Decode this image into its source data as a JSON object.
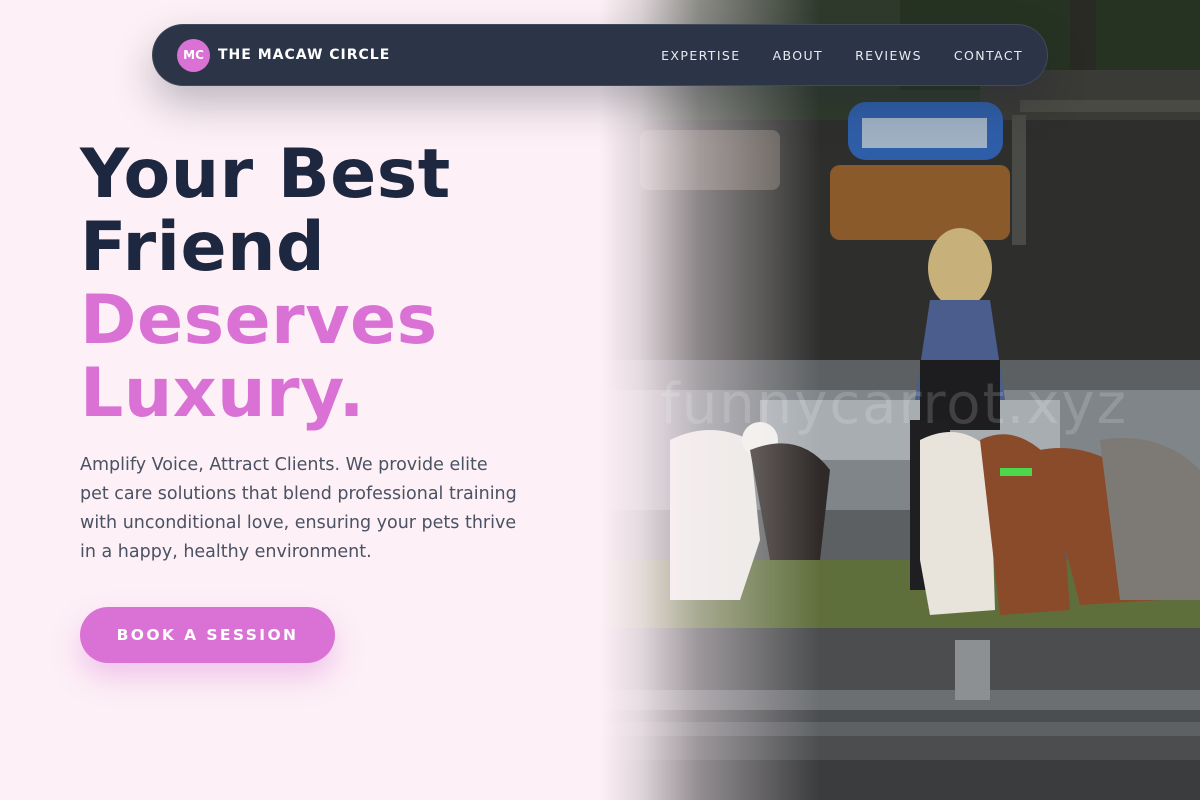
{
  "nav": {
    "logo_initials": "MC",
    "brand_name": "THE MACAW CIRCLE",
    "links": [
      "EXPERTISE",
      "ABOUT",
      "REVIEWS",
      "CONTACT"
    ]
  },
  "hero": {
    "title_line1": "Your Best",
    "title_line2": "Friend",
    "title_line3": "Deserves",
    "title_line4": "Luxury.",
    "description": "Amplify Voice, Attract Clients. We provide elite pet care solutions that blend professional training with unconditional love, ensuring your pets thrive in a happy, healthy environment.",
    "cta_label": "BOOK A SESSION",
    "image_watermark": "funnycarrot.xyz"
  },
  "colors": {
    "accent": "#da72d6",
    "navy": "#1e2740",
    "nav_bg": "#2c3547",
    "page_bg": "#fdf0f6"
  }
}
